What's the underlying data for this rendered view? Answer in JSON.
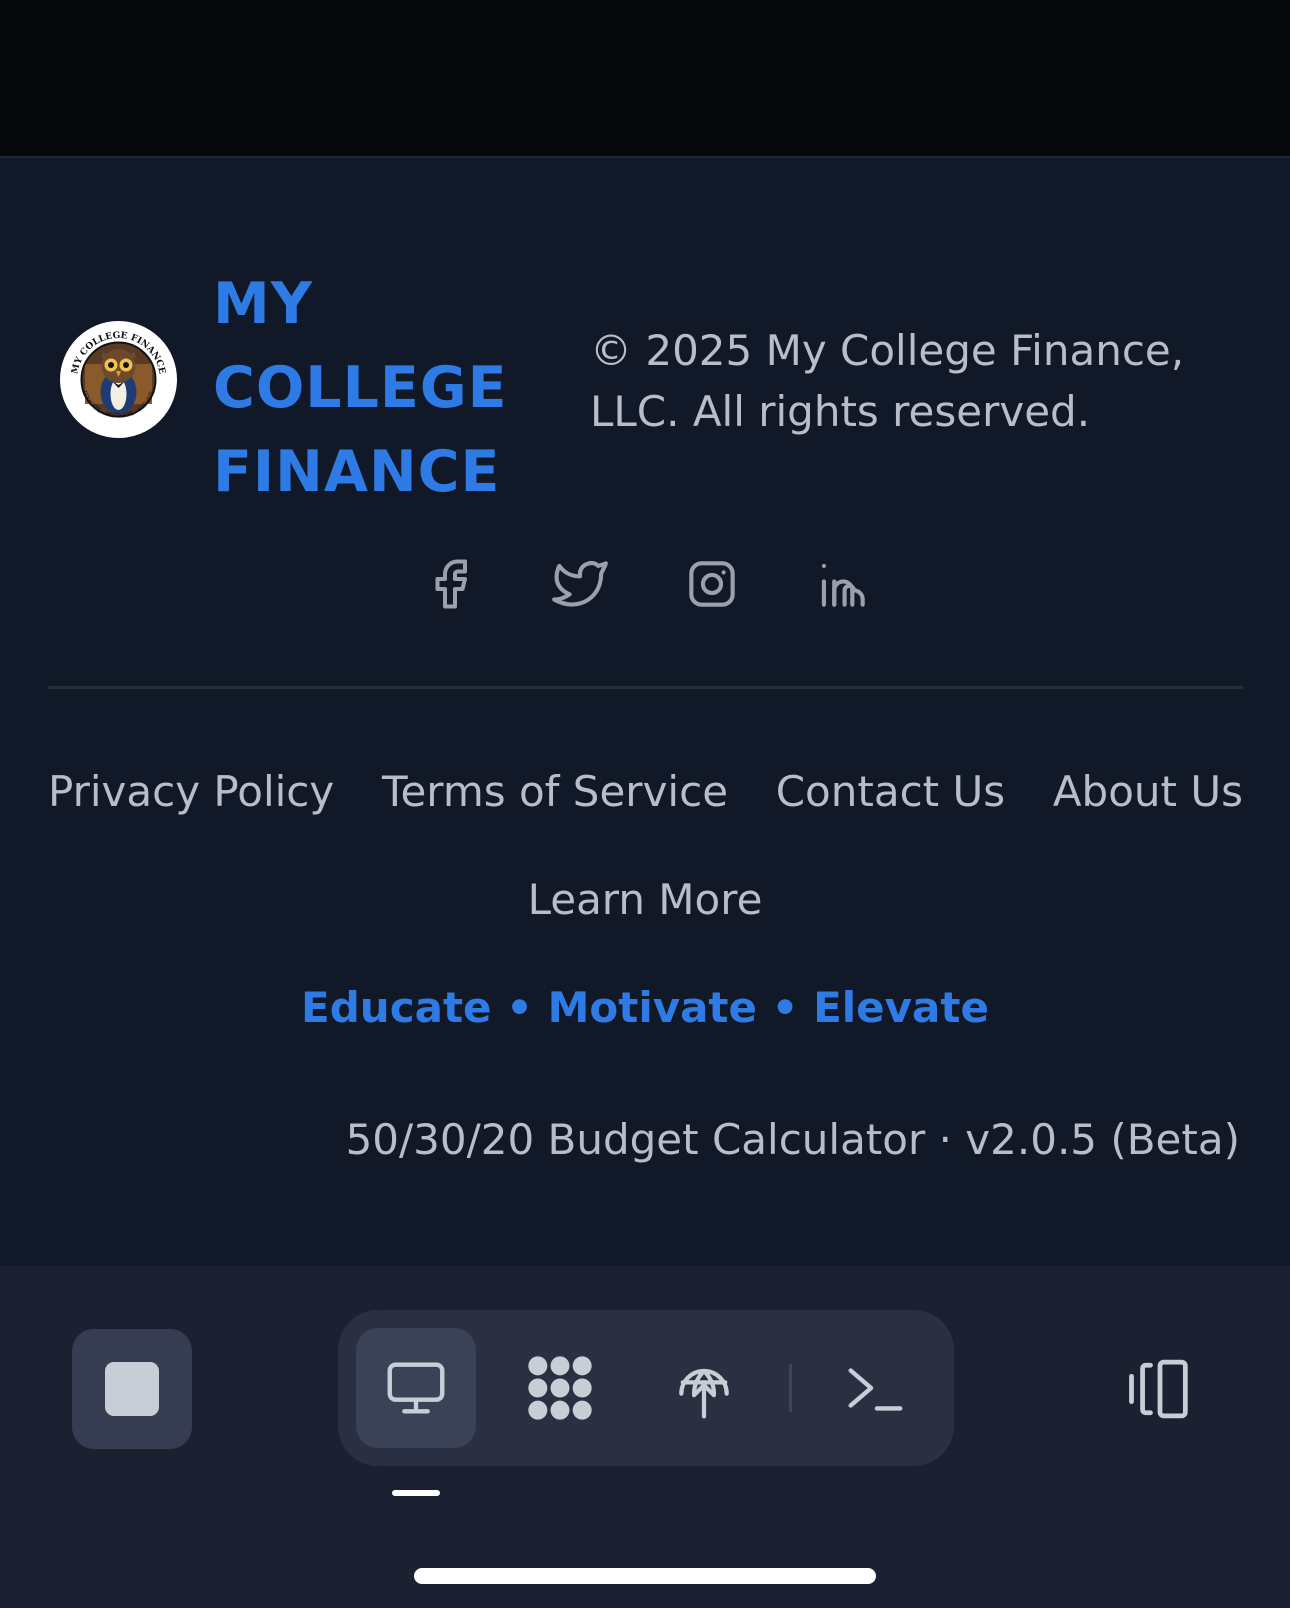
{
  "footer": {
    "brand_name": "MY\nCOLLEGE\nFINANCE",
    "logo_text_top": "MY COLLEGE FINANCE",
    "logo_text_bottom": "EDUCATE · MOTIVATE · ELEVATE",
    "copyright": "© 2025 My College Finance, LLC. All rights reserved.",
    "socials": [
      {
        "icon": "facebook-icon"
      },
      {
        "icon": "twitter-icon"
      },
      {
        "icon": "instagram-icon"
      },
      {
        "icon": "linkedin-icon"
      }
    ],
    "links": {
      "privacy": "Privacy Policy",
      "terms": "Terms of Service",
      "contact": "Contact Us",
      "about": "About Us",
      "learn_more": "Learn More"
    },
    "tagline": "Educate • Motivate • Elevate",
    "version": "50/30/20 Budget Calculator · v2.0.5 (Beta)"
  },
  "toolbar": {
    "stop_icon": "stop-icon",
    "tabs": [
      {
        "icon": "desktop-icon",
        "active": true
      },
      {
        "icon": "apps-grid-icon",
        "active": false
      },
      {
        "icon": "deploy-globe-icon",
        "active": false
      },
      {
        "icon": "terminal-icon",
        "active": false
      }
    ],
    "panel_icon": "side-panel-icon"
  },
  "colors": {
    "background": "#111827",
    "accent": "#2f7be6",
    "text_muted": "#b8bec8",
    "toolbar_bg": "#1c2131"
  }
}
